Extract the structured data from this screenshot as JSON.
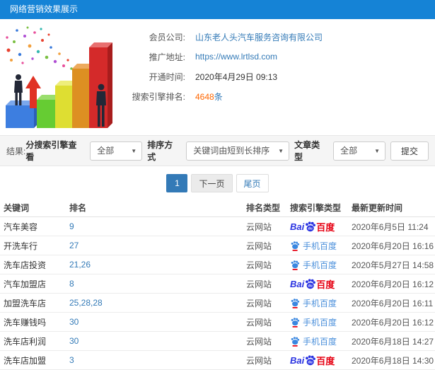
{
  "colors": {
    "accent": "#1583d6",
    "link": "#337ab7",
    "highlight": "#ff6600",
    "baidu-blue": "#2932e1",
    "baidu-red": "#e60012"
  },
  "header": {
    "title": "网络营销效果展示"
  },
  "info": {
    "rows": [
      {
        "label": "会员公司:",
        "value": "山东老人头汽车服务咨询有限公司"
      },
      {
        "label": "推广地址:",
        "value": "https://www.lrtlsd.com"
      },
      {
        "label": "开通时间:",
        "value": "2020年4月29日 09:13"
      },
      {
        "label": "搜索引擎排名:",
        "value": "4648",
        "suffix": "条"
      }
    ]
  },
  "filters": {
    "result_label": "结果:",
    "engine_label": "分搜索引擎查看",
    "engine_value": "全部",
    "sort_label": "排序方式",
    "sort_value": "关键词由短到长排序",
    "article_label": "文章类型",
    "article_value": "全部",
    "submit_label": "提交"
  },
  "pagination": {
    "current": "1",
    "next": "下一页",
    "last": "尾页"
  },
  "engines": {
    "baidu": {
      "prefix": "Bai",
      "pad": "du",
      "suffix": "百度"
    },
    "mobile": {
      "label": "手机百度"
    }
  },
  "table": {
    "headers": [
      "关键词",
      "排名",
      "排名类型",
      "搜索引擎类型",
      "最新更新时间"
    ],
    "rows": [
      {
        "keyword": "汽车美容",
        "rank": "9",
        "rank_type": "云网站",
        "engine": "baidu",
        "updated": "2020年6月5日 11:24"
      },
      {
        "keyword": "开洗车行",
        "rank": "27",
        "rank_type": "云网站",
        "engine": "mobile",
        "updated": "2020年6月20日 16:16"
      },
      {
        "keyword": "洗车店投资",
        "rank": "21,26",
        "rank_type": "云网站",
        "engine": "mobile",
        "updated": "2020年5月27日 14:58"
      },
      {
        "keyword": "汽车加盟店",
        "rank": "8",
        "rank_type": "云网站",
        "engine": "baidu",
        "updated": "2020年6月20日 16:12"
      },
      {
        "keyword": "加盟洗车店",
        "rank": "25,28,28",
        "rank_type": "云网站",
        "engine": "mobile",
        "updated": "2020年6月20日 16:11"
      },
      {
        "keyword": "洗车赚钱吗",
        "rank": "30",
        "rank_type": "云网站",
        "engine": "mobile",
        "updated": "2020年6月20日 16:12"
      },
      {
        "keyword": "洗车店利润",
        "rank": "30",
        "rank_type": "云网站",
        "engine": "mobile",
        "updated": "2020年6月18日 14:27"
      },
      {
        "keyword": "洗车店加盟",
        "rank": "3",
        "rank_type": "云网站",
        "engine": "baidu",
        "updated": "2020年6月18日 14:30"
      }
    ]
  }
}
